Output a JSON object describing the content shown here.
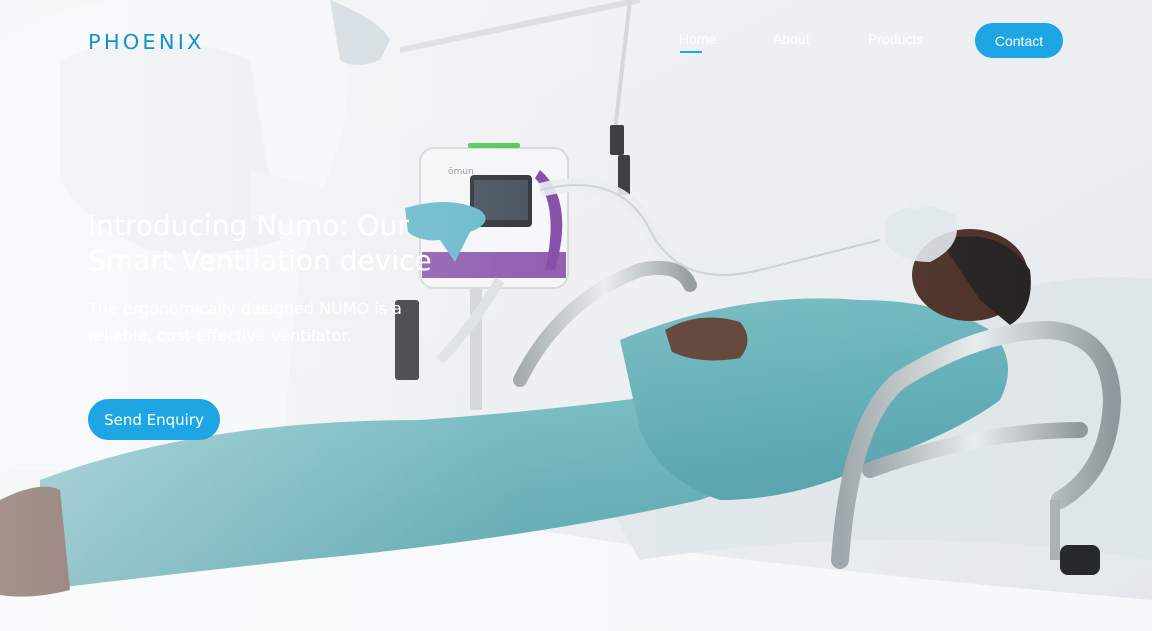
{
  "brand": {
    "logo": "PHOENIX"
  },
  "nav": {
    "items": [
      {
        "label": "Home",
        "active": true
      },
      {
        "label": "About"
      },
      {
        "label": "Products"
      }
    ],
    "contact_label": "Contact"
  },
  "hero": {
    "title": "Introducing Numo: Our Smart Ventilation device",
    "subtitle": "The ergonomically designed NUMO is a reliable, cost-effective ventilator.",
    "cta_label": "Send Enquiry",
    "device_brand": "ōmun"
  },
  "colors": {
    "accent": "#1ea5e3",
    "logo": "#1692c8",
    "scrubs": "#5aa9b1",
    "device_purple": "#7b3fa1"
  }
}
